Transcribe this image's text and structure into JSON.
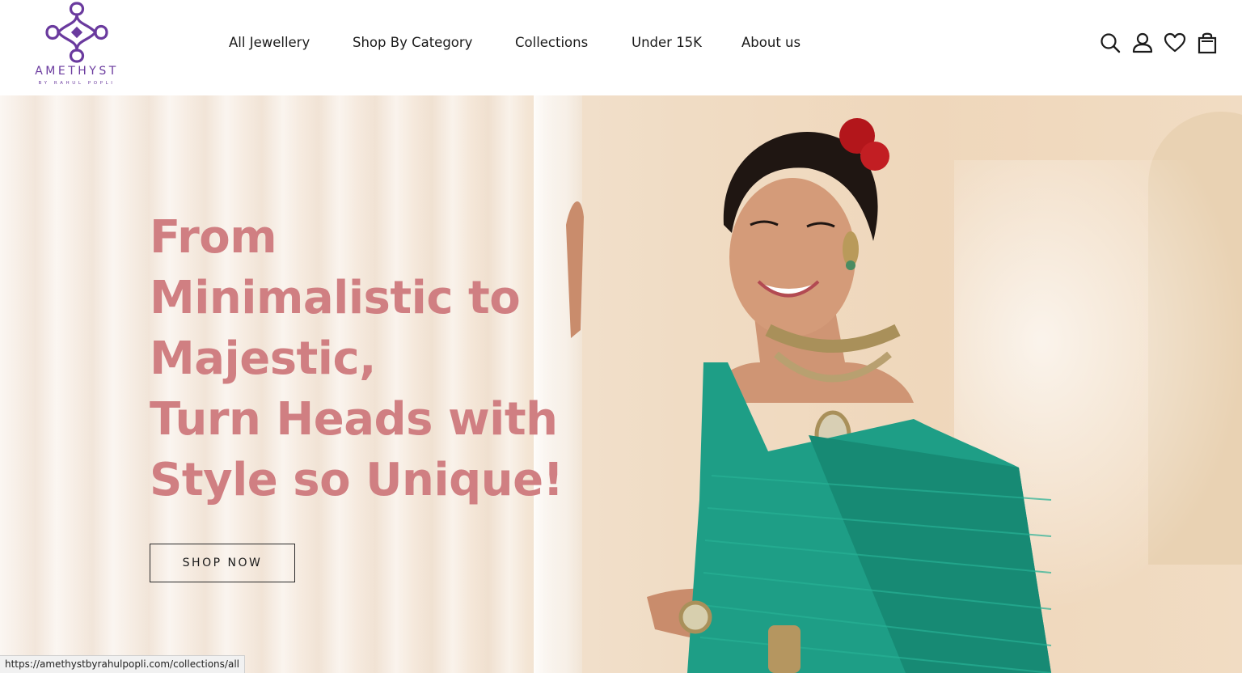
{
  "brand": {
    "name": "AMETHYST",
    "tagline": "BY RAHUL POPLI",
    "color": "#6a3a9e"
  },
  "nav": {
    "items": [
      {
        "label": "All Jewellery"
      },
      {
        "label": "Shop By Category"
      },
      {
        "label": "Collections"
      },
      {
        "label": "Under 15K"
      },
      {
        "label": "About us"
      }
    ]
  },
  "header_icons": [
    "search-icon",
    "account-icon",
    "wishlist-heart-icon",
    "cart-bag-icon"
  ],
  "hero": {
    "headline_lines": [
      "From",
      "Minimalistic to",
      "Majestic,",
      "Turn Heads with",
      "Style so Unique!"
    ],
    "headline_color": "#d07f82",
    "cta_label": "SHOP NOW"
  },
  "status_bar": {
    "url": "https://amethystbyrahulpopli.com/collections/all"
  }
}
